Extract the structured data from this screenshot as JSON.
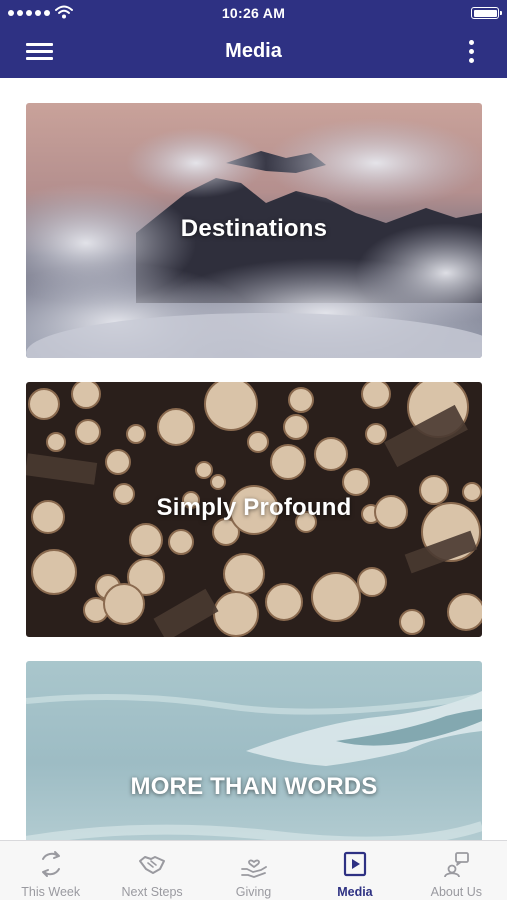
{
  "status_bar": {
    "time": "10:26 AM"
  },
  "header": {
    "title": "Media",
    "menu_icon": "hamburger-menu-icon",
    "more_icon": "vertical-ellipsis-icon"
  },
  "cards": [
    {
      "title": "Destinations"
    },
    {
      "title": "Simply Profound"
    },
    {
      "title": "MORE THAN WORDS"
    }
  ],
  "tabs": [
    {
      "label": "This Week",
      "icon": "refresh-icon",
      "active": false
    },
    {
      "label": "Next Steps",
      "icon": "handshake-icon",
      "active": false
    },
    {
      "label": "Giving",
      "icon": "giving-hand-icon",
      "active": false
    },
    {
      "label": "Media",
      "icon": "play-icon",
      "active": true
    },
    {
      "label": "About Us",
      "icon": "about-icon",
      "active": false
    }
  ],
  "colors": {
    "brand": "#2e3183",
    "tab_inactive": "#9a9aa0",
    "background": "#ffffff"
  }
}
